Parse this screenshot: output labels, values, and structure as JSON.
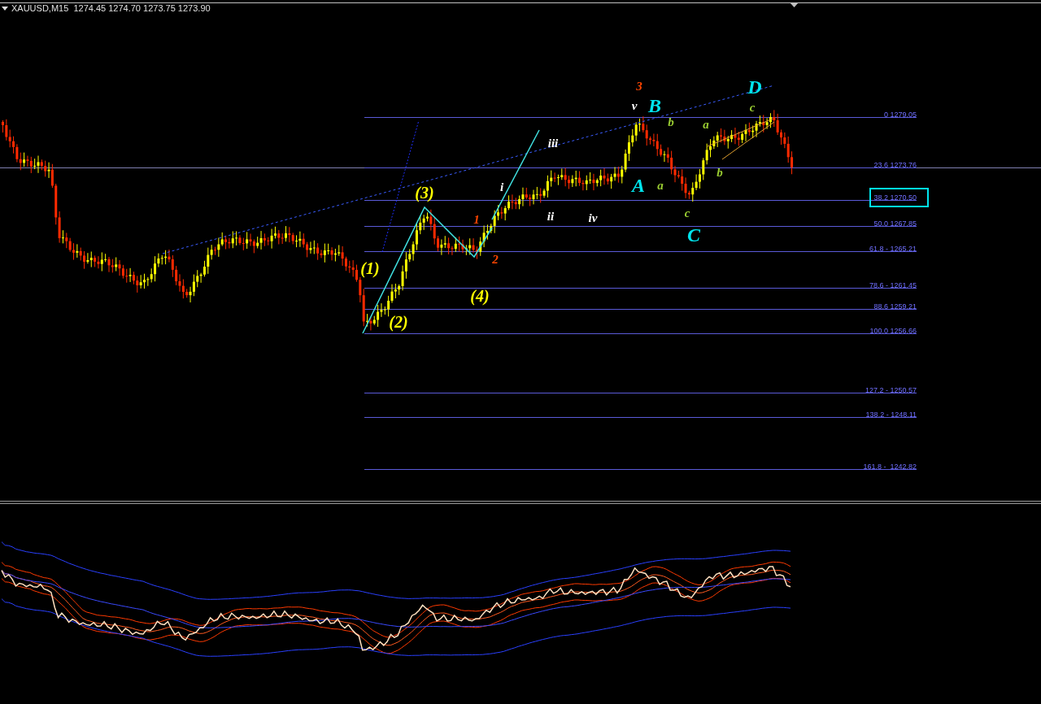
{
  "header": {
    "text": "XAUUSD,M15  1274.45 1274.70 1273.75 1273.90"
  },
  "fib_levels": [
    {
      "label": "0 1279.05",
      "highlighted": false
    },
    {
      "label": "23.6 1273.76",
      "highlighted": false
    },
    {
      "label": "38.2 1270.50",
      "highlighted": true
    },
    {
      "label": "50.0 1267.85",
      "highlighted": false
    },
    {
      "label": "61.8 - 1265.21",
      "highlighted": false
    },
    {
      "label": "78.6 - 1261.45",
      "highlighted": false
    },
    {
      "label": "88.6 1259.21",
      "highlighted": false
    },
    {
      "label": "100.0 1256.66",
      "highlighted": false
    },
    {
      "label": "127.2 - 1250.57",
      "highlighted": false
    },
    {
      "label": "138.2 - 1248.11",
      "highlighted": false
    },
    {
      "label": "161.8 -  1242.82",
      "highlighted": false
    }
  ],
  "wave_labels": [
    {
      "text": "(1)",
      "color": "#ffff00"
    },
    {
      "text": "(2)",
      "color": "#ffff00"
    },
    {
      "text": "(3)",
      "color": "#ffff00"
    },
    {
      "text": "(4)",
      "color": "#ffff00"
    },
    {
      "text": "1",
      "color": "#ff4500"
    },
    {
      "text": "2",
      "color": "#ff4500"
    },
    {
      "text": "3",
      "color": "#ff4500"
    },
    {
      "text": "i",
      "color": "#ffffff"
    },
    {
      "text": "ii",
      "color": "#ffffff"
    },
    {
      "text": "iii",
      "color": "#ffffff"
    },
    {
      "text": "iv",
      "color": "#ffffff"
    },
    {
      "text": "v",
      "color": "#ffffff"
    },
    {
      "text": "A",
      "color": "#00e5ee"
    },
    {
      "text": "B",
      "color": "#00e5ee"
    },
    {
      "text": "C",
      "color": "#00e5ee"
    },
    {
      "text": "D",
      "color": "#00e5ee"
    },
    {
      "text": "a",
      "color": "#9acd32"
    },
    {
      "text": "b",
      "color": "#9acd32"
    },
    {
      "text": "c",
      "color": "#9acd32"
    },
    {
      "text": "a",
      "color": "#9acd32"
    },
    {
      "text": "b",
      "color": "#9acd32"
    },
    {
      "text": "c",
      "color": "#9acd32"
    }
  ]
}
